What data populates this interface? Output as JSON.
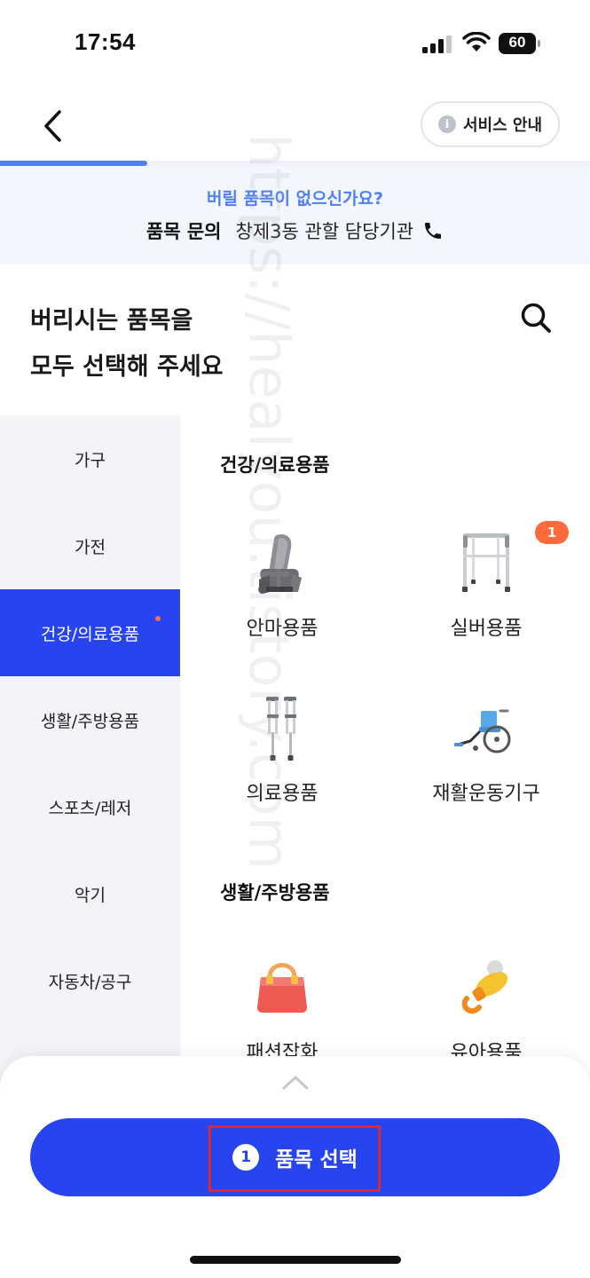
{
  "status_bar": {
    "time": "17:54",
    "battery": "60"
  },
  "header": {
    "service_label": "서비스 안내",
    "info_glyph": "i"
  },
  "progress": {
    "fraction": 0.25
  },
  "banner": {
    "question": "버릴 품목이 없으신가요?",
    "inquiry_label": "품목 문의",
    "agency": "창제3동 관할 담당기관"
  },
  "page_title": {
    "line1": "버리시는 품목을",
    "line2": "모두 선택해 주세요"
  },
  "sidebar": {
    "items": [
      {
        "label": "가구"
      },
      {
        "label": "가전"
      },
      {
        "label": "건강/의료용품",
        "active": true,
        "has_dot": true
      },
      {
        "label": "생활/주방용품"
      },
      {
        "label": "스포츠/레저"
      },
      {
        "label": "악기"
      },
      {
        "label": "자동차/공구"
      }
    ]
  },
  "sections": [
    {
      "title": "건강/의료용품",
      "items": [
        {
          "label": "안마용품",
          "icon": "massage-chair-icon"
        },
        {
          "label": "실버용품",
          "icon": "walker-icon",
          "badge": "1"
        },
        {
          "label": "의료용품",
          "icon": "crutches-icon"
        },
        {
          "label": "재활운동기구",
          "icon": "wheelchair-icon"
        }
      ]
    },
    {
      "title": "생활/주방용품",
      "items": [
        {
          "label": "패션잡화",
          "icon": "handbag-icon"
        },
        {
          "label": "유아용품",
          "icon": "pacifier-icon"
        }
      ]
    }
  ],
  "bottom": {
    "count": "1",
    "select_label": "품목 선택"
  },
  "watermark": "https://healyou.tistory.com"
}
